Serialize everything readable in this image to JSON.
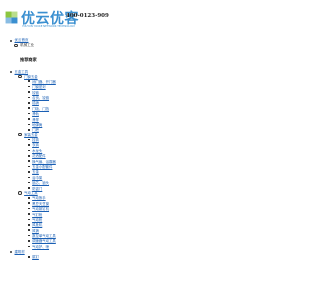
{
  "header": {
    "logo_text": "优云优客",
    "logo_subtext": "YOUYUN YOUKE NETWORK TECHNOLOGY",
    "phone": "400-0123-909",
    "colors": {
      "brand_blue": "#3a8fd0",
      "brand_green": "#8cc63f",
      "link": "#1a5fb4"
    }
  },
  "breadcrumb": {
    "home": "优云首页",
    "current": "机械工业"
  },
  "section_title": "推荐商家",
  "categories": [
    {
      "label": "五金工具",
      "groups": [
        {
          "label": "门窗五金",
          "items": [
            "闭门器、开门器",
            "门窗密封",
            "铰链",
            "合页、铰链",
            "插销",
            "门吸、门挡",
            "滑轨",
            "滑撑",
            "地弹簧",
            "门把"
          ]
        },
        {
          "label": "家装五金",
          "items": [
            "挂钩",
            "衣钩",
            "水龙头",
            "花洒配件",
            "换气扇、浴霸器",
            "五金小配套件",
            "五金",
            "浴巾架",
            "锁芯、锁头",
            "防盗门"
          ]
        },
        {
          "label": "气动工具",
          "items": [
            "气动扳手",
            "黑豆天豆窗",
            "气动铆钉机",
            "气钉枪",
            "气动枪",
            "风批机",
            "风镐",
            "数控单气动工具",
            "调速器气动工具",
            "气动护、喷"
          ]
        }
      ]
    },
    {
      "label": "建筑材",
      "groups": [
        {
          "label": "",
          "items": [
            "腻钉"
          ]
        }
      ]
    }
  ]
}
